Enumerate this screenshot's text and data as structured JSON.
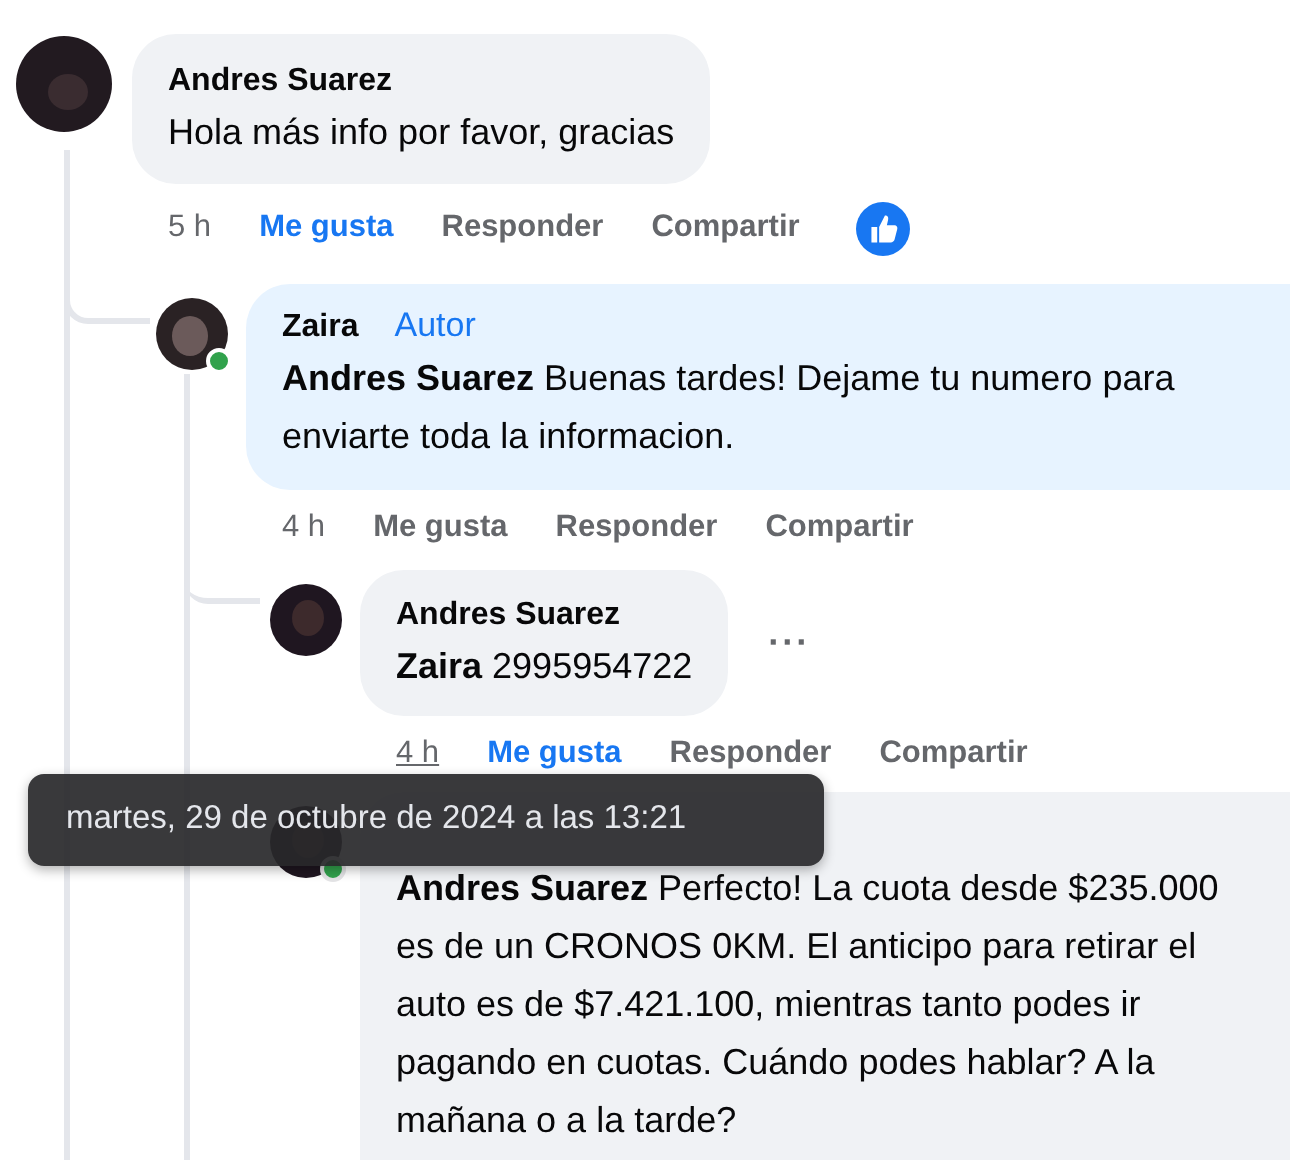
{
  "comments": [
    {
      "author": "Andres Suarez",
      "text": "Hola más info por favor, gracias",
      "time": "5 h",
      "time_hovered": false,
      "like_label": "Me gusta",
      "liked": true,
      "reply_label": "Responder",
      "share_label": "Compartir",
      "reactions": [
        {
          "kind": "like"
        }
      ],
      "children": [
        {
          "author": "Zaira",
          "badge": "Autor",
          "online": true,
          "text": "**Andres Suarez** Buenas tardes! Dejame tu numero para enviarte toda la informacion.",
          "time": "4 h",
          "time_hovered": false,
          "like_label": "Me gusta",
          "liked": false,
          "reply_label": "Responder",
          "share_label": "Compartir",
          "children": [
            {
              "author": "Andres Suarez",
              "text": "**Zaira** 2995954722",
              "more": "···",
              "time": "4 h",
              "time_hovered": true,
              "like_label": "Me gusta",
              "liked": true,
              "reply_label": "Responder",
              "share_label": "Compartir"
            },
            {
              "online": true,
              "text": "**Andres Suarez** Perfecto! La cuota desde $235.000 es de un CRONOS 0KM. El anticipo para retirar el auto es de $7.421.100, mientras tanto podes ir pagando en cuotas. Cuándo podes hablar? A la mañana o a la tarde?"
            }
          ]
        }
      ]
    }
  ],
  "tooltip": "martes, 29 de octubre de 2024 a las 13:21"
}
